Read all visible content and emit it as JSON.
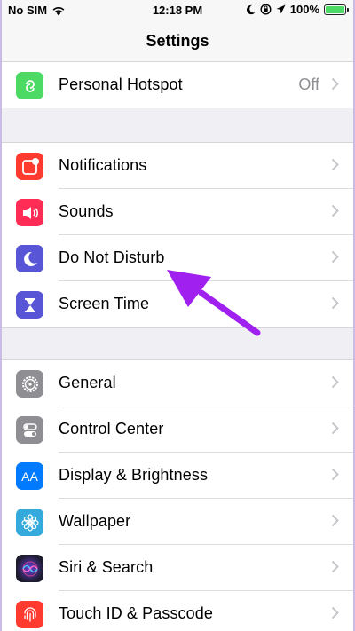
{
  "status_bar": {
    "carrier": "No SIM",
    "time": "12:18 PM",
    "battery": "100%",
    "battery_level": 1.0
  },
  "nav": {
    "title": "Settings"
  },
  "colors": {
    "hotspot": "#4cd964",
    "notifications": "#ff3b30",
    "sounds": "#ff2d55",
    "do_not_disturb": "#5856d6",
    "screen_time": "#5856d6",
    "general": "#8e8e93",
    "control_center": "#8e8e93",
    "display": "#007aff",
    "wallpaper": "#34aadc",
    "siri": "#1c1c2e",
    "touch_id": "#ff3b30",
    "arrow": "#a020f0"
  },
  "groups": [
    {
      "items": [
        {
          "label": "Personal Hotspot",
          "value": "Off",
          "icon": "hotspot-icon"
        }
      ]
    },
    {
      "items": [
        {
          "label": "Notifications",
          "icon": "notifications-icon"
        },
        {
          "label": "Sounds",
          "icon": "sounds-icon"
        },
        {
          "label": "Do Not Disturb",
          "icon": "moon-icon"
        },
        {
          "label": "Screen Time",
          "icon": "hourglass-icon"
        }
      ]
    },
    {
      "items": [
        {
          "label": "General",
          "icon": "gear-icon"
        },
        {
          "label": "Control Center",
          "icon": "toggles-icon"
        },
        {
          "label": "Display & Brightness",
          "icon": "aa-icon"
        },
        {
          "label": "Wallpaper",
          "icon": "flower-icon"
        },
        {
          "label": "Siri & Search",
          "icon": "siri-icon"
        },
        {
          "label": "Touch ID & Passcode",
          "icon": "fingerprint-icon"
        }
      ]
    }
  ],
  "icon_text": {
    "display": "AA"
  }
}
